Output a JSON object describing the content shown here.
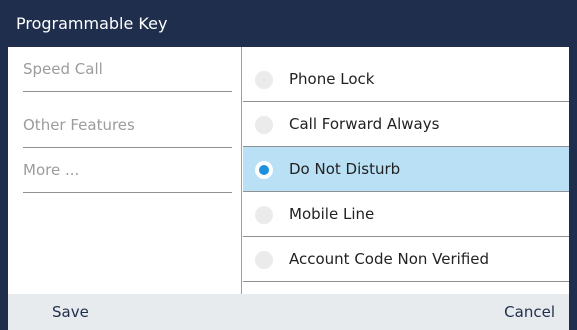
{
  "header": {
    "title": "Programmable Key"
  },
  "left_menu": {
    "items": [
      {
        "label": "Speed Call"
      },
      {
        "label": "Other Features"
      },
      {
        "label": "More ..."
      }
    ]
  },
  "options": {
    "items": [
      {
        "label": "Phone Lock",
        "selected": false
      },
      {
        "label": "Call Forward Always",
        "selected": false
      },
      {
        "label": "Do Not Disturb",
        "selected": true
      },
      {
        "label": "Mobile Line",
        "selected": false
      },
      {
        "label": "Account Code Non Verified",
        "selected": false
      }
    ]
  },
  "footer": {
    "save_label": "Save",
    "cancel_label": "Cancel"
  },
  "colors": {
    "title_bar": "#1e2e4c",
    "selected_row": "#b9e0f5",
    "radio_selected": "#1d8fdc",
    "footer_bg": "#e8ebee"
  }
}
